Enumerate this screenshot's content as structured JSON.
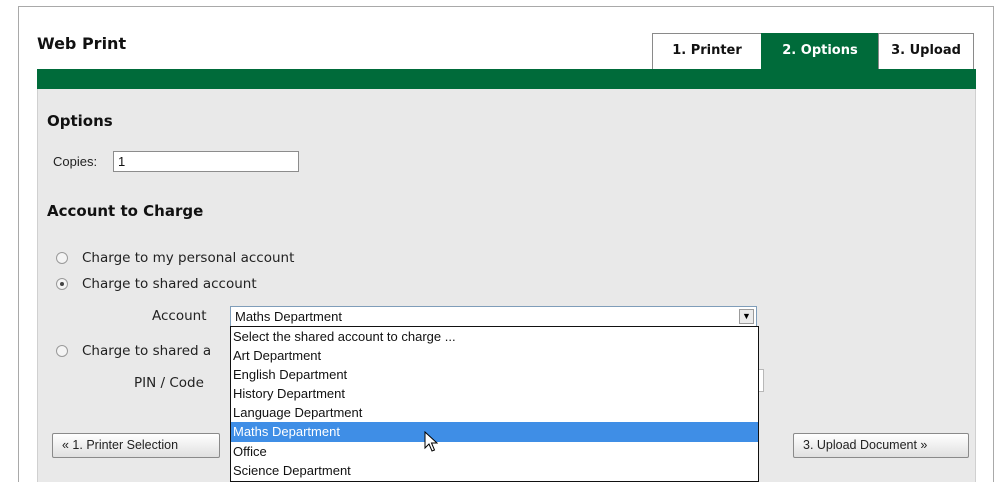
{
  "app": {
    "title": "Web Print"
  },
  "tabs": [
    {
      "label": "1. Printer"
    },
    {
      "label": "2. Options"
    },
    {
      "label": "3. Upload"
    }
  ],
  "options": {
    "heading": "Options",
    "copies_label": "Copies:",
    "copies_value": "1"
  },
  "account": {
    "heading": "Account to Charge",
    "radio_personal": "Charge to my personal account",
    "radio_shared": "Charge to shared account",
    "radio_shared_pin": "Charge to shared a",
    "account_label": "Account",
    "selected": "Maths Department",
    "pin_label": "PIN / Code"
  },
  "dropdown": {
    "options": [
      "Select the shared account to charge ...",
      "Art Department",
      "English Department",
      "History Department",
      "Language Department",
      "Maths Department",
      "Office",
      "Science Department"
    ]
  },
  "buttons": {
    "prev": "« 1. Printer Selection",
    "next": "3. Upload Document »"
  },
  "colors": {
    "accent_green": "#006b3a",
    "highlight_blue": "#3f8ee6"
  },
  "icons": {
    "select_arrow": "chevron-down-icon",
    "mouse_cursor": "cursor-arrow-icon"
  }
}
